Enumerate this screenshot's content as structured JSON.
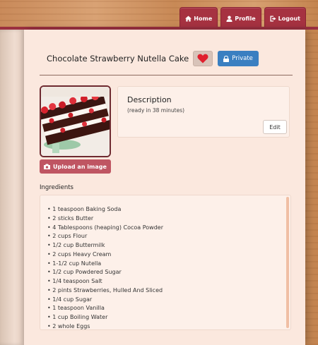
{
  "nav": {
    "home": "Home",
    "profile": "Profile",
    "logout": "Logout"
  },
  "recipe": {
    "title": "Chocolate Strawberry Nutella Cake",
    "private_label": "Private",
    "upload_label": "Upload an image",
    "description_title": "Description",
    "ready_text": "(ready in 38 minutes)",
    "edit_label": "Edit",
    "ingredients_label": "Ingredients",
    "ingredients": [
      "1 teaspoon Baking Soda",
      "2 sticks Butter",
      "4 Tablespoons (heaping) Cocoa Powder",
      "2 cups Flour",
      "1/2 cup Buttermilk",
      "2 cups Heavy Cream",
      "1-1/2 cup Nutella",
      "1/2 cup Powdered Sugar",
      "1/4 teaspoon Salt",
      "2 pints Strawberries, Hulled And Sliced",
      "1/4 cup Sugar",
      "1 teaspoon Vanilla",
      "1 cup Boiling Water",
      "2 whole Eggs"
    ]
  },
  "colors": {
    "nav_red": "#a63241",
    "heart": "#e0202e",
    "private_blue": "#3a7fc1",
    "upload_red": "#bf5562",
    "page_bg": "#fbe8de"
  },
  "icons": {
    "home": "home-icon",
    "profile": "user-icon",
    "logout": "logout-icon",
    "favorite": "heart-icon",
    "private": "lock-icon",
    "upload": "camera-icon"
  }
}
